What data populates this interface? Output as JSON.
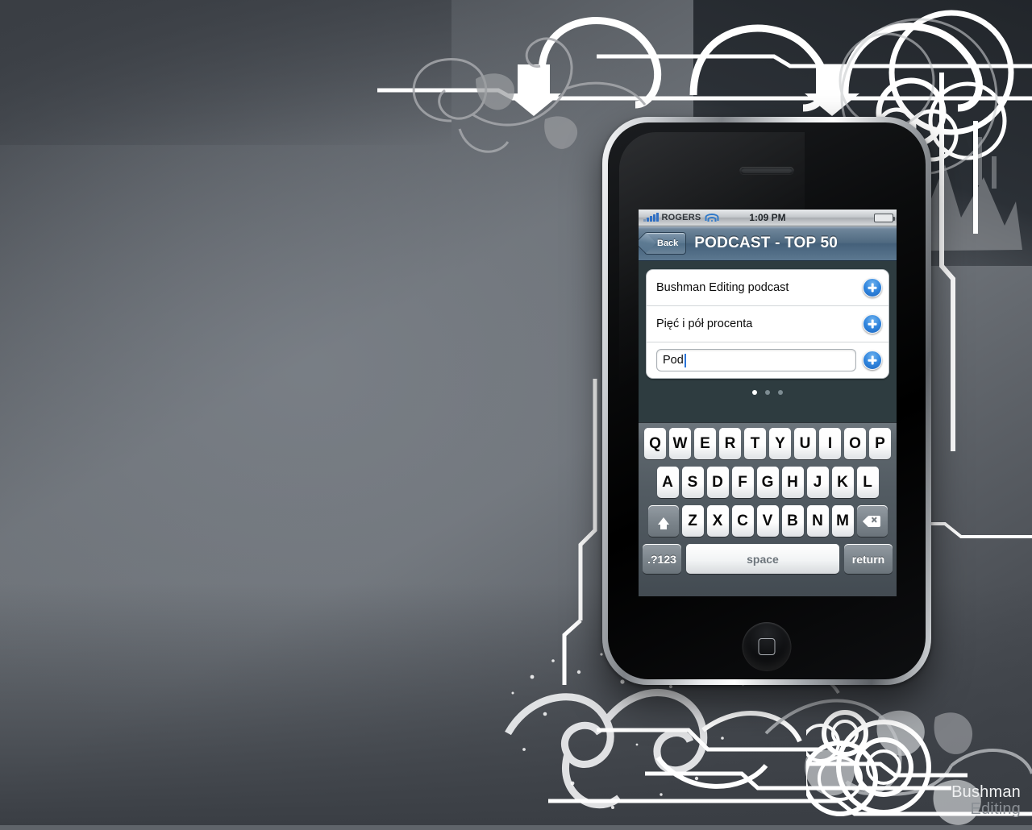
{
  "wallpaper": {
    "watermark": {
      "line1": "Bushman",
      "line2": "Editing"
    },
    "accent_white": "#ffffff",
    "base_gray": "#6d7278"
  },
  "phone": {
    "device": "iPhone 3G",
    "home_button_name": "home-button"
  },
  "statusbar": {
    "carrier": "ROGERS",
    "time": "1:09 PM",
    "signal_bars": 5,
    "wifi": "wifi-icon",
    "battery_level": "full",
    "battery_color": "#5fba18"
  },
  "navbar": {
    "back_label": "Back",
    "title": "PODCAST - TOP 50",
    "tint": "#4e6980"
  },
  "list": {
    "rows": [
      {
        "label": "Bushman Editing podcast",
        "action": "add"
      },
      {
        "label": "Pięć i pół procenta",
        "action": "add"
      }
    ],
    "input_row": {
      "value": "Pod",
      "placeholder": "",
      "action": "add"
    },
    "add_icon": "plus-icon",
    "accent": "#2f84dd"
  },
  "pager": {
    "total": 3,
    "active_index": 0
  },
  "keyboard": {
    "layout": "qwerty-uppercase",
    "row1": [
      "Q",
      "W",
      "E",
      "R",
      "T",
      "Y",
      "U",
      "I",
      "O",
      "P"
    ],
    "row2": [
      "A",
      "S",
      "D",
      "F",
      "G",
      "H",
      "J",
      "K",
      "L"
    ],
    "row3_letters": [
      "Z",
      "X",
      "C",
      "V",
      "B",
      "N",
      "M"
    ],
    "shift_label": "",
    "delete_label": "",
    "numeric_label": ".?123",
    "space_label": "space",
    "return_label": "return"
  }
}
